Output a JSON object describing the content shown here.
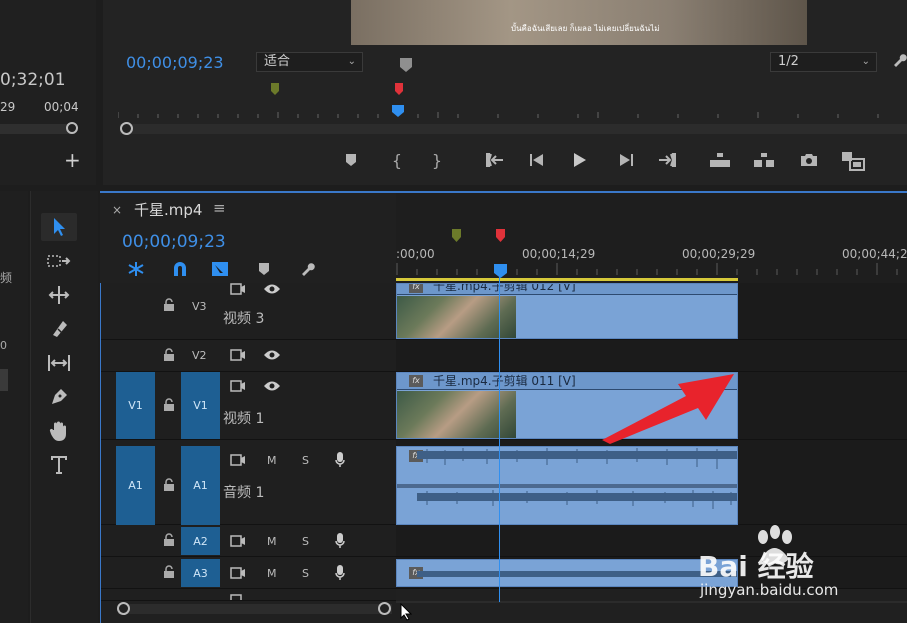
{
  "left_panel": {
    "timecode_1": "0;32;01",
    "timecode_2": "29",
    "timecode_3": "00;04"
  },
  "monitor": {
    "subtitle": "บั้นคือฉันเสียเลย ก็เผลอ ไม่เคยเปลี่ยนฉันไม่",
    "timecode": "00;00;09;23",
    "fit_dropdown": "适合",
    "resolution_dropdown": "1/2"
  },
  "timeline": {
    "tab_title": "千星.mp4",
    "timecode": "00;00;09;23",
    "ruler_labels": [
      ":00;00",
      "00;00;14;29",
      "00;00;29;29",
      "00;00;44;2"
    ]
  },
  "tracks": {
    "v3": {
      "label": "V3",
      "name": "视频 3"
    },
    "v2": {
      "label": "V2"
    },
    "v1": {
      "label": "V1",
      "target": "V1",
      "name": "视频 1"
    },
    "a1": {
      "label": "A1",
      "target": "A1",
      "name": "音频 1",
      "m": "M",
      "s": "S"
    },
    "a2": {
      "label": "A2",
      "m": "M",
      "s": "S"
    },
    "a3": {
      "label": "A3",
      "m": "M",
      "s": "S"
    }
  },
  "clips": {
    "v3_title": "千星.mp4.子剪辑 012 [V]",
    "v1_title": "千星.mp4.子剪辑 011 [V]",
    "fx": "fx"
  },
  "watermark": {
    "brand": "Bai  经验",
    "url": "jingyan.baidu.com"
  },
  "colors": {
    "accent": "#3f8fe6",
    "clip": "#7aa3d6",
    "target": "#1e5f93",
    "playhead": "#2f8ff0",
    "marker_red": "#e0323a",
    "marker_green": "#6c7a2a",
    "arrow": "#e8232c"
  }
}
